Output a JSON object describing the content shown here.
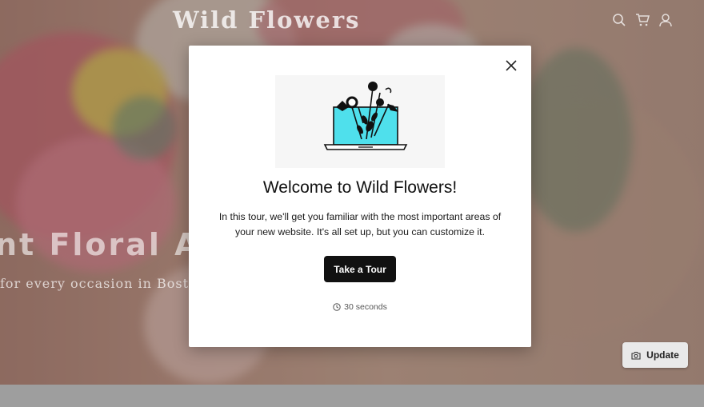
{
  "header": {
    "brand": "Wild Flowers",
    "icons": [
      "search-icon",
      "cart-icon",
      "account-icon"
    ]
  },
  "hero": {
    "title_fragment": "nt Floral Ar",
    "subtitle_fragment": "for every occasion in Bosto"
  },
  "modal": {
    "title": "Welcome to Wild Flowers!",
    "body": "In this tour, we'll get you familiar with the most important areas of your new website. It's all set up, but you can customize it.",
    "cta_label": "Take a Tour",
    "duration": "30 seconds",
    "icons": [
      "close-icon",
      "laptop-flowers-illustration",
      "clock-icon"
    ],
    "illustration_accent": "#4fe0ec"
  },
  "update_button": {
    "label": "Update",
    "icon": "camera-icon"
  }
}
